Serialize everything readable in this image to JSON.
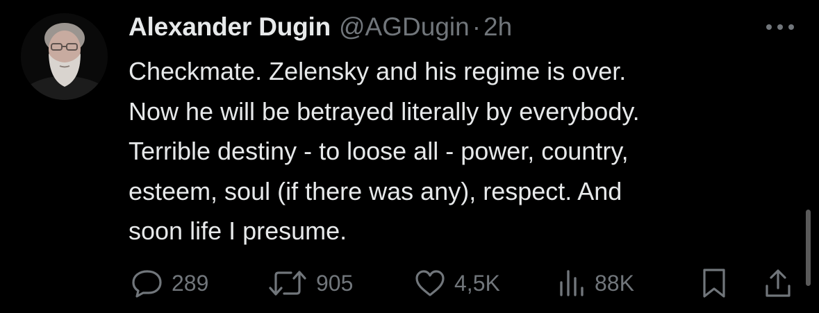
{
  "tweet": {
    "author": {
      "display_name": "Alexander Dugin",
      "handle": "@AGDugin",
      "separator": "·",
      "timestamp": "2h"
    },
    "text_lines": [
      "Checkmate. Zelensky and his regime is over.",
      "Now he will be betrayed literally by everybody.",
      "Terrible destiny - to loose all - power, country,",
      "esteem, soul (if there was any), respect. And",
      "soon life I presume."
    ],
    "stats": {
      "replies": "289",
      "reposts": "905",
      "likes": "4,5K",
      "views": "88K"
    }
  },
  "icons": {
    "more": "more-horizontal-icon",
    "reply": "reply-bubble-icon",
    "retweet": "retweet-icon",
    "like": "heart-icon",
    "views": "views-bar-chart-icon",
    "bookmark": "bookmark-icon",
    "share": "share-upload-icon"
  },
  "colors": {
    "background": "#000000",
    "primary_text": "#e7e9ea",
    "secondary_text": "#71767b"
  }
}
